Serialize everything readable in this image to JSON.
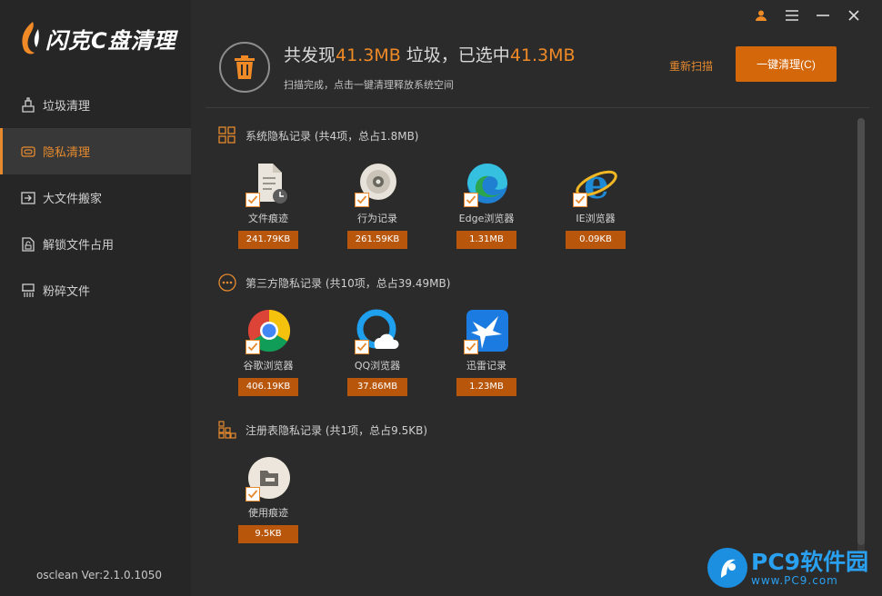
{
  "app": {
    "logo_text": "闪克C盘清理",
    "version": "osclean Ver:2.1.0.1050"
  },
  "sidebar": {
    "items": [
      {
        "label": "垃圾清理",
        "icon": "broom-icon"
      },
      {
        "label": "隐私清理",
        "icon": "privacy-icon",
        "active": true
      },
      {
        "label": "大文件搬家",
        "icon": "move-icon"
      },
      {
        "label": "解锁文件占用",
        "icon": "unlock-file-icon"
      },
      {
        "label": "粉碎文件",
        "icon": "shredder-icon"
      }
    ]
  },
  "header": {
    "prefix": "共发现",
    "found": "41.3MB",
    "middle": "垃圾，已选中",
    "selected": "41.3MB",
    "subtitle": "扫描完成，点击一键清理释放系统空间",
    "rescan_label": "重新扫描",
    "clean_label": "一键清理(C)"
  },
  "sections": [
    {
      "title": "系统隐私记录 (共4项，总占1.8MB)",
      "items": [
        {
          "label": "文件痕迹",
          "size": "241.79KB",
          "icon": "file-trace-icon",
          "checked": true
        },
        {
          "label": "行为记录",
          "size": "261.59KB",
          "icon": "behavior-record-icon",
          "checked": true
        },
        {
          "label": "Edge浏览器",
          "size": "1.31MB",
          "icon": "edge-browser-icon",
          "checked": true
        },
        {
          "label": "IE浏览器",
          "size": "0.09KB",
          "icon": "ie-browser-icon",
          "checked": true
        }
      ]
    },
    {
      "title": "第三方隐私记录 (共10项，总占39.49MB)",
      "items": [
        {
          "label": "谷歌浏览器",
          "size": "406.19KB",
          "icon": "chrome-browser-icon",
          "checked": true
        },
        {
          "label": "QQ浏览器",
          "size": "37.86MB",
          "icon": "qq-browser-icon",
          "checked": true
        },
        {
          "label": "迅雷记录",
          "size": "1.23MB",
          "icon": "xunlei-icon",
          "checked": true
        }
      ]
    },
    {
      "title": "注册表隐私记录 (共1项，总占9.5KB)",
      "items": [
        {
          "label": "使用痕迹",
          "size": "9.5KB",
          "icon": "usage-trace-icon",
          "checked": true
        }
      ]
    }
  ],
  "watermark": {
    "main": "PC9软件园",
    "sub": "www.PC9.com"
  },
  "colors": {
    "accent": "#e58a2e",
    "button": "#d4670a",
    "size_badge": "#b8570c",
    "background": "#2b2b2b",
    "sidebar": "#262626"
  }
}
